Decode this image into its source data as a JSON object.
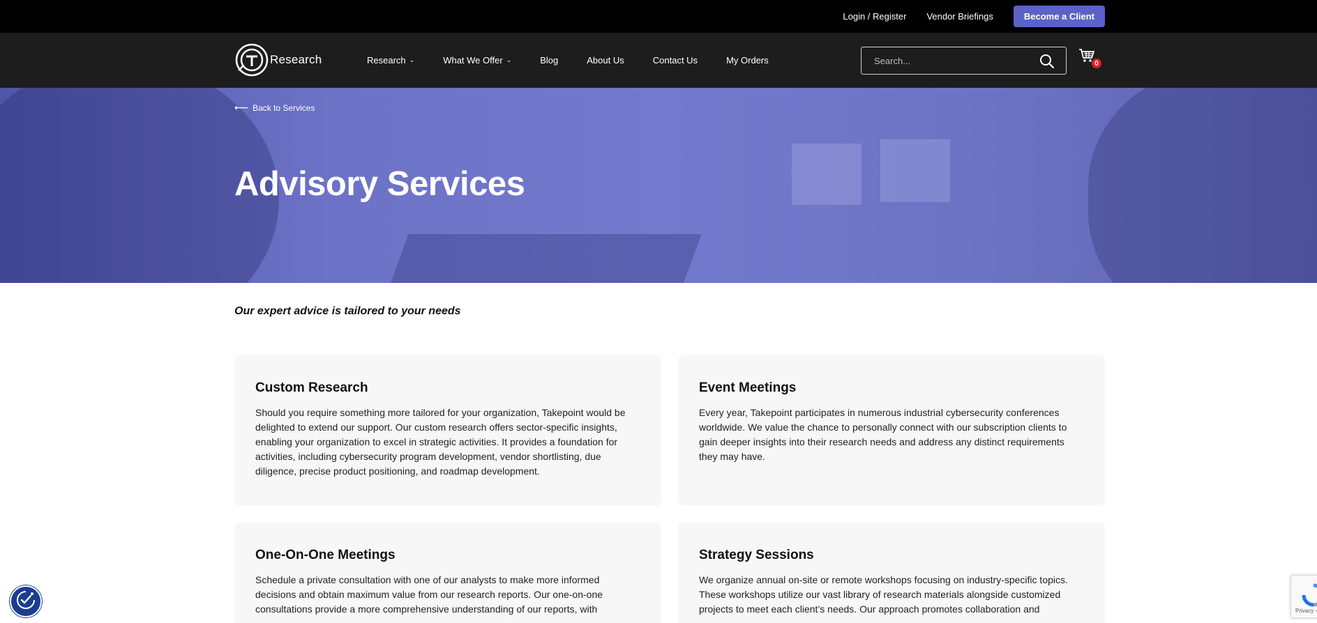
{
  "topbar": {
    "login_label": "Login / Register",
    "vendor_label": "Vendor Briefings",
    "cta_label": "Become a Client"
  },
  "nav": {
    "logo_text": "Research",
    "items": [
      {
        "label": "Research",
        "has_dropdown": true
      },
      {
        "label": "What We Offer",
        "has_dropdown": true
      },
      {
        "label": "Blog",
        "has_dropdown": false
      },
      {
        "label": "About Us",
        "has_dropdown": false
      },
      {
        "label": "Contact Us",
        "has_dropdown": false
      },
      {
        "label": "My Orders",
        "has_dropdown": false
      }
    ],
    "search_placeholder": "Search...",
    "cart_count": "0"
  },
  "hero": {
    "back_label": "Back to Services",
    "title": "Advisory Services"
  },
  "tagline": "Our expert advice is tailored to your needs",
  "cards": [
    {
      "title": "Custom Research",
      "body": "Should you require something more tailored for your organization, Takepoint would be delighted to extend our support. Our custom research offers sector-specific insights, enabling your organization to excel in strategic activities. It provides a foundation for activities, including cybersecurity program development, vendor shortlisting, due diligence, precise product positioning, and roadmap development."
    },
    {
      "title": "Event Meetings",
      "body": "Every year, Takepoint participates in numerous industrial cybersecurity conferences worldwide. We value the chance to personally connect with our subscription clients to gain deeper insights into their research needs and address any distinct requirements they may have."
    },
    {
      "title": "One-On-One Meetings",
      "body": "Schedule a private consultation with one of our analysts to make more informed decisions and obtain maximum value from our research reports. Our one-on-one consultations provide a more comprehensive understanding of our reports, with"
    },
    {
      "title": "Strategy Sessions",
      "body": "We organize annual on-site or remote workshops focusing on industry-specific topics. These workshops utilize our vast library of research materials alongside customized projects to meet each client’s needs. Our approach promotes collaboration and"
    }
  ],
  "widgets": {
    "recaptcha_label": "Privacy - Te"
  },
  "colors": {
    "accent": "#5b62c8",
    "nav_bg": "#1d1d1d",
    "topbar_bg": "#000000",
    "hero_tint": "#6c72c6",
    "card_bg": "#f7f7f7",
    "badge": "#e01f1f"
  }
}
